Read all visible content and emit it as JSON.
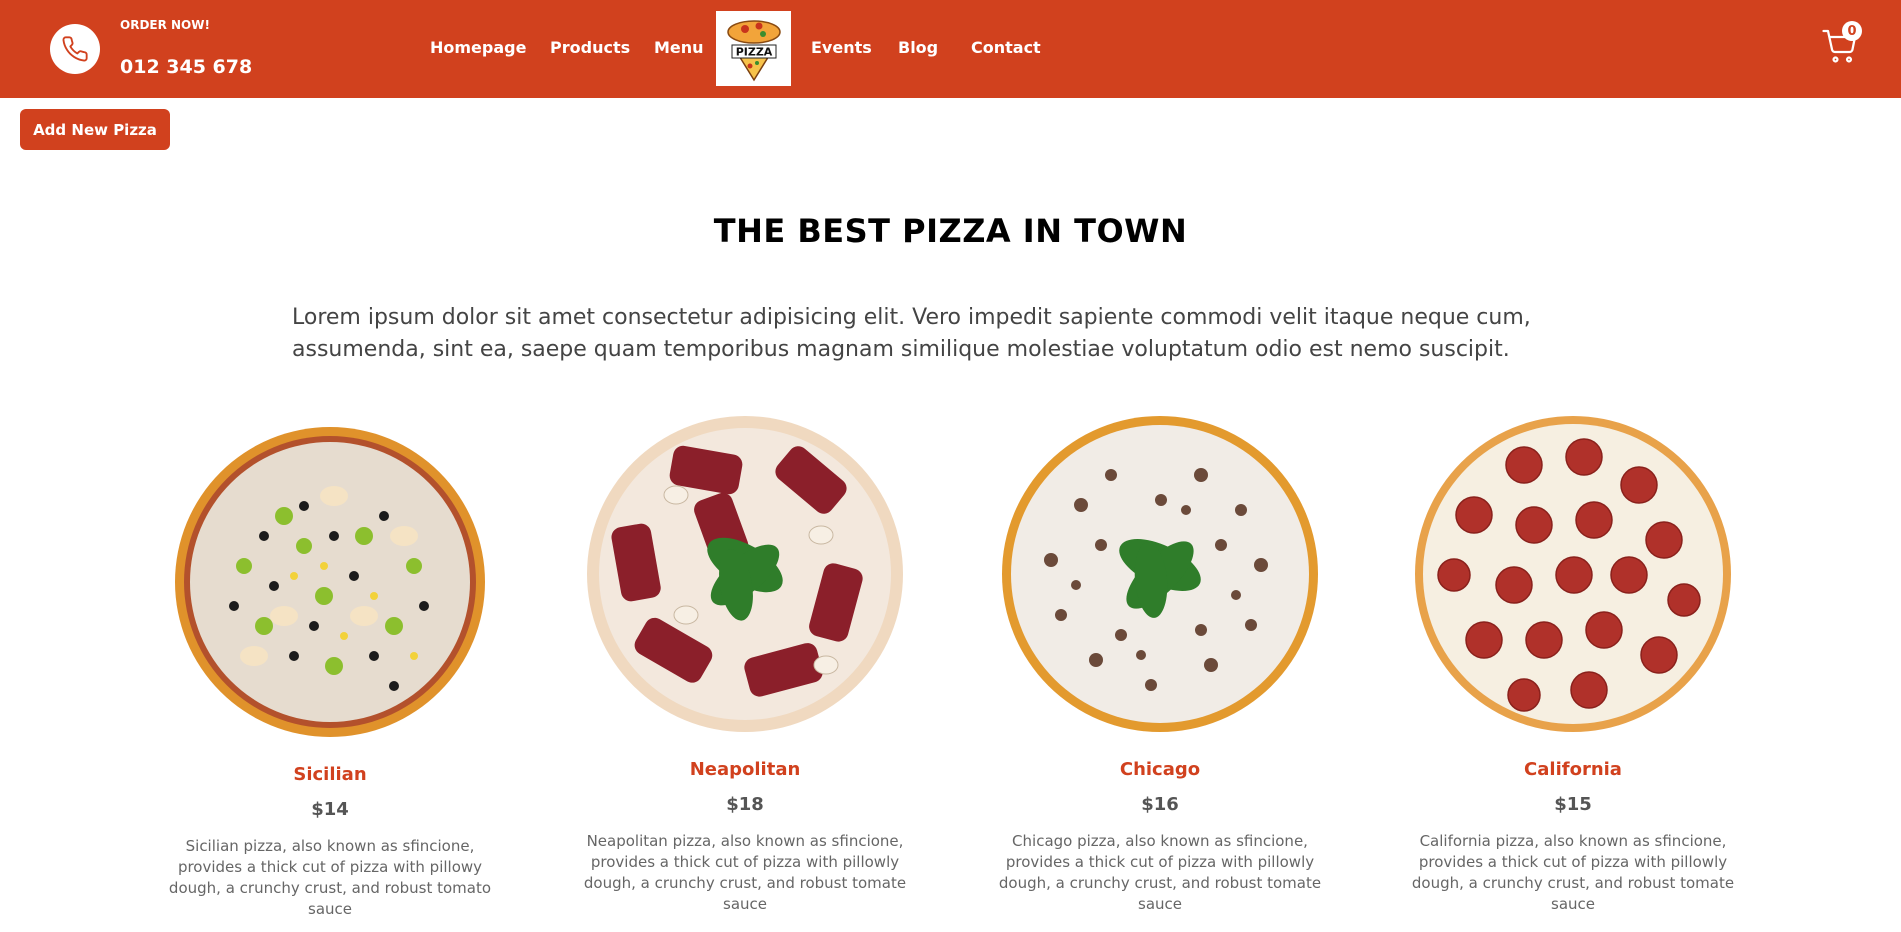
{
  "header": {
    "order_label": "ORDER NOW!",
    "phone": "012 345 678",
    "nav": [
      "Homepage",
      "Products",
      "Menu",
      "Events",
      "Blog",
      "Contact"
    ],
    "logo_text": "PIZZA",
    "cart_count": "0"
  },
  "actions": {
    "add_pizza": "Add New Pizza"
  },
  "main": {
    "title": "THE BEST PIZZA IN TOWN",
    "description": "Lorem ipsum dolor sit amet consectetur adipisicing elit. Vero impedit sapiente commodi velit itaque neque cum, assumenda, sint ea, saepe quam temporibus magnam similique molestiae voluptatum odio est nemo suscipit."
  },
  "pizzas": [
    {
      "name": "Sicilian",
      "price": "$14",
      "desc": "Sicilian pizza, also known as sfincione, provides a thick cut of pizza with pillowy dough, a crunchy crust, and robust tomato sauce"
    },
    {
      "name": "Neapolitan",
      "price": "$18",
      "desc": "Neapolitan pizza, also known as sfincione, provides a thick cut of pizza with pillowly dough, a crunchy crust, and robust tomate sauce"
    },
    {
      "name": "Chicago",
      "price": "$16",
      "desc": "Chicago pizza, also known as sfincione, provides a thick cut of pizza with pillowly dough, a crunchy crust, and robust tomate sauce"
    },
    {
      "name": "California",
      "price": "$15",
      "desc": "California pizza, also known as sfincione, provides a thick cut of pizza with pillowly dough, a crunchy crust, and robust tomate sauce"
    }
  ],
  "colors": {
    "brand": "#d1411e",
    "text": "#222222",
    "muted": "#666666"
  }
}
